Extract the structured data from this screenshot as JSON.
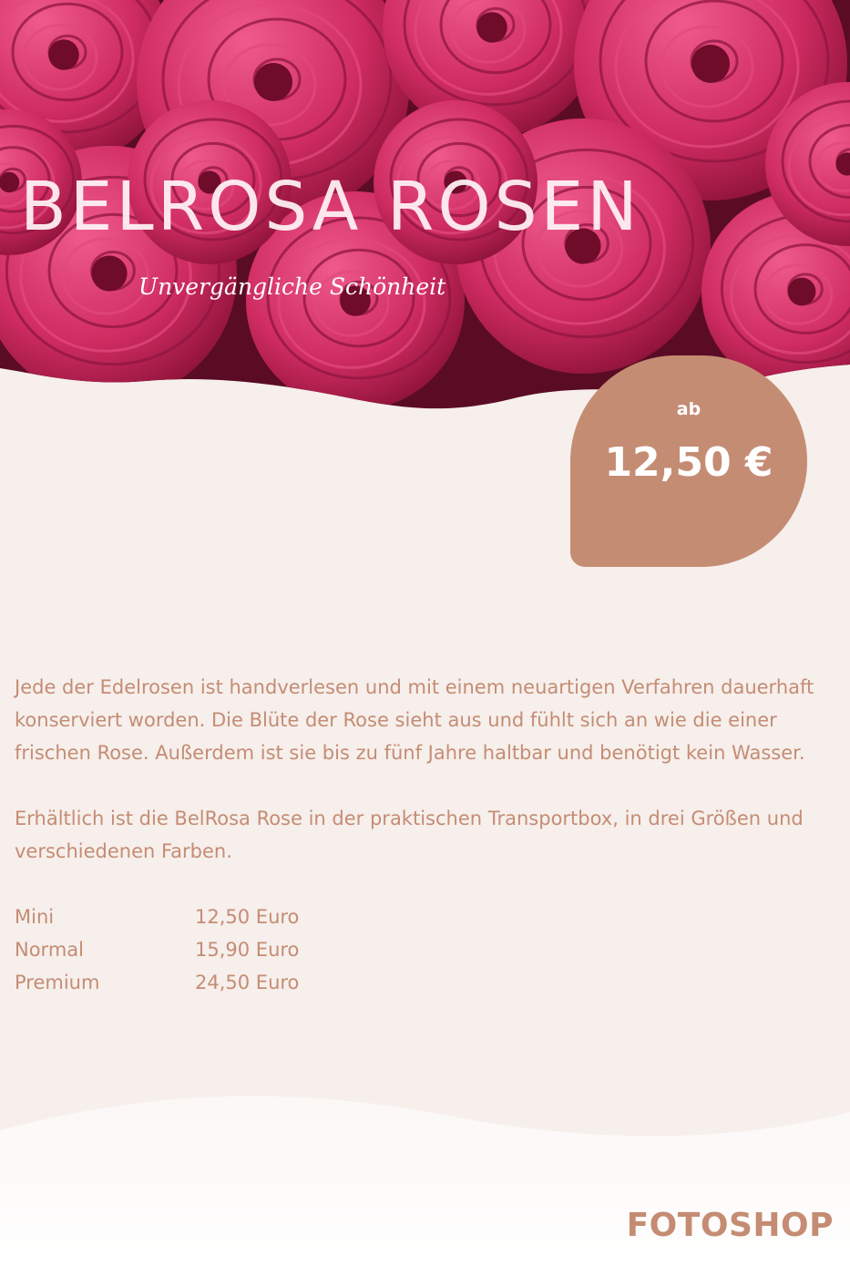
{
  "hero": {
    "title": "BELROSA ROSEN",
    "subtitle": "Unvergängliche Schönheit"
  },
  "price_badge": {
    "prefix": "ab",
    "value": "12,50 €"
  },
  "description": {
    "paragraph_1": "Jede der Edelrosen ist handverlesen und mit einem neuartigen Verfahren dauerhaft konserviert worden. Die Blüte der Rose sieht aus und fühlt sich an wie die einer frischen Rose. Außerdem ist sie bis zu fünf Jahre haltbar und benötigt kein Wasser.",
    "paragraph_2": "Erhältlich ist die BelRosa Rose in der praktischen Transportbox, in drei Größen und verschiedenen Farben."
  },
  "prices": [
    {
      "size": "Mini",
      "price": "12,50 Euro"
    },
    {
      "size": "Normal",
      "price": "15,90 Euro"
    },
    {
      "size": "Premium",
      "price": "24,50 Euro"
    }
  ],
  "brand": "FOTOSHOP",
  "colors": {
    "accent": "#c58c74",
    "background": "#f6efeb",
    "rose": "#c8285f"
  }
}
